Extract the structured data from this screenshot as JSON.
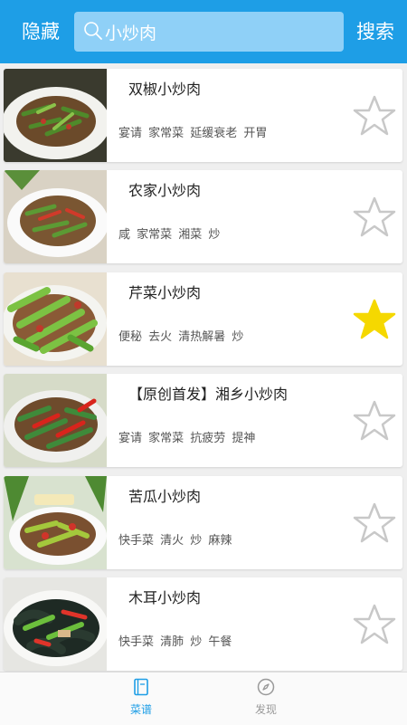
{
  "header": {
    "hide_label": "隐藏",
    "search_value": "小炒肉",
    "search_label": "搜索"
  },
  "recipes": [
    {
      "title": "双椒小炒肉",
      "tags": "宴请 家常菜 延缓衰老 开胃",
      "favorited": false
    },
    {
      "title": "农家小炒肉",
      "tags": "咸 家常菜 湘菜 炒",
      "favorited": false
    },
    {
      "title": "芹菜小炒肉",
      "tags": "便秘 去火 清热解暑 炒",
      "favorited": true
    },
    {
      "title": "【原创首发】湘乡小炒肉",
      "tags": "宴请 家常菜 抗疲劳 提神",
      "favorited": false
    },
    {
      "title": "苦瓜小炒肉",
      "tags": "快手菜 清火 炒 麻辣",
      "favorited": false
    },
    {
      "title": "木耳小炒肉",
      "tags": "快手菜 清肺 炒 午餐",
      "favorited": false
    }
  ],
  "tabs": [
    {
      "label": "菜谱",
      "active": true
    },
    {
      "label": "发现",
      "active": false
    }
  ],
  "colors": {
    "accent": "#1e9ee6",
    "star_active": "#f5d800",
    "star_inactive": "#c8c8c8",
    "tab_inactive": "#999999"
  }
}
